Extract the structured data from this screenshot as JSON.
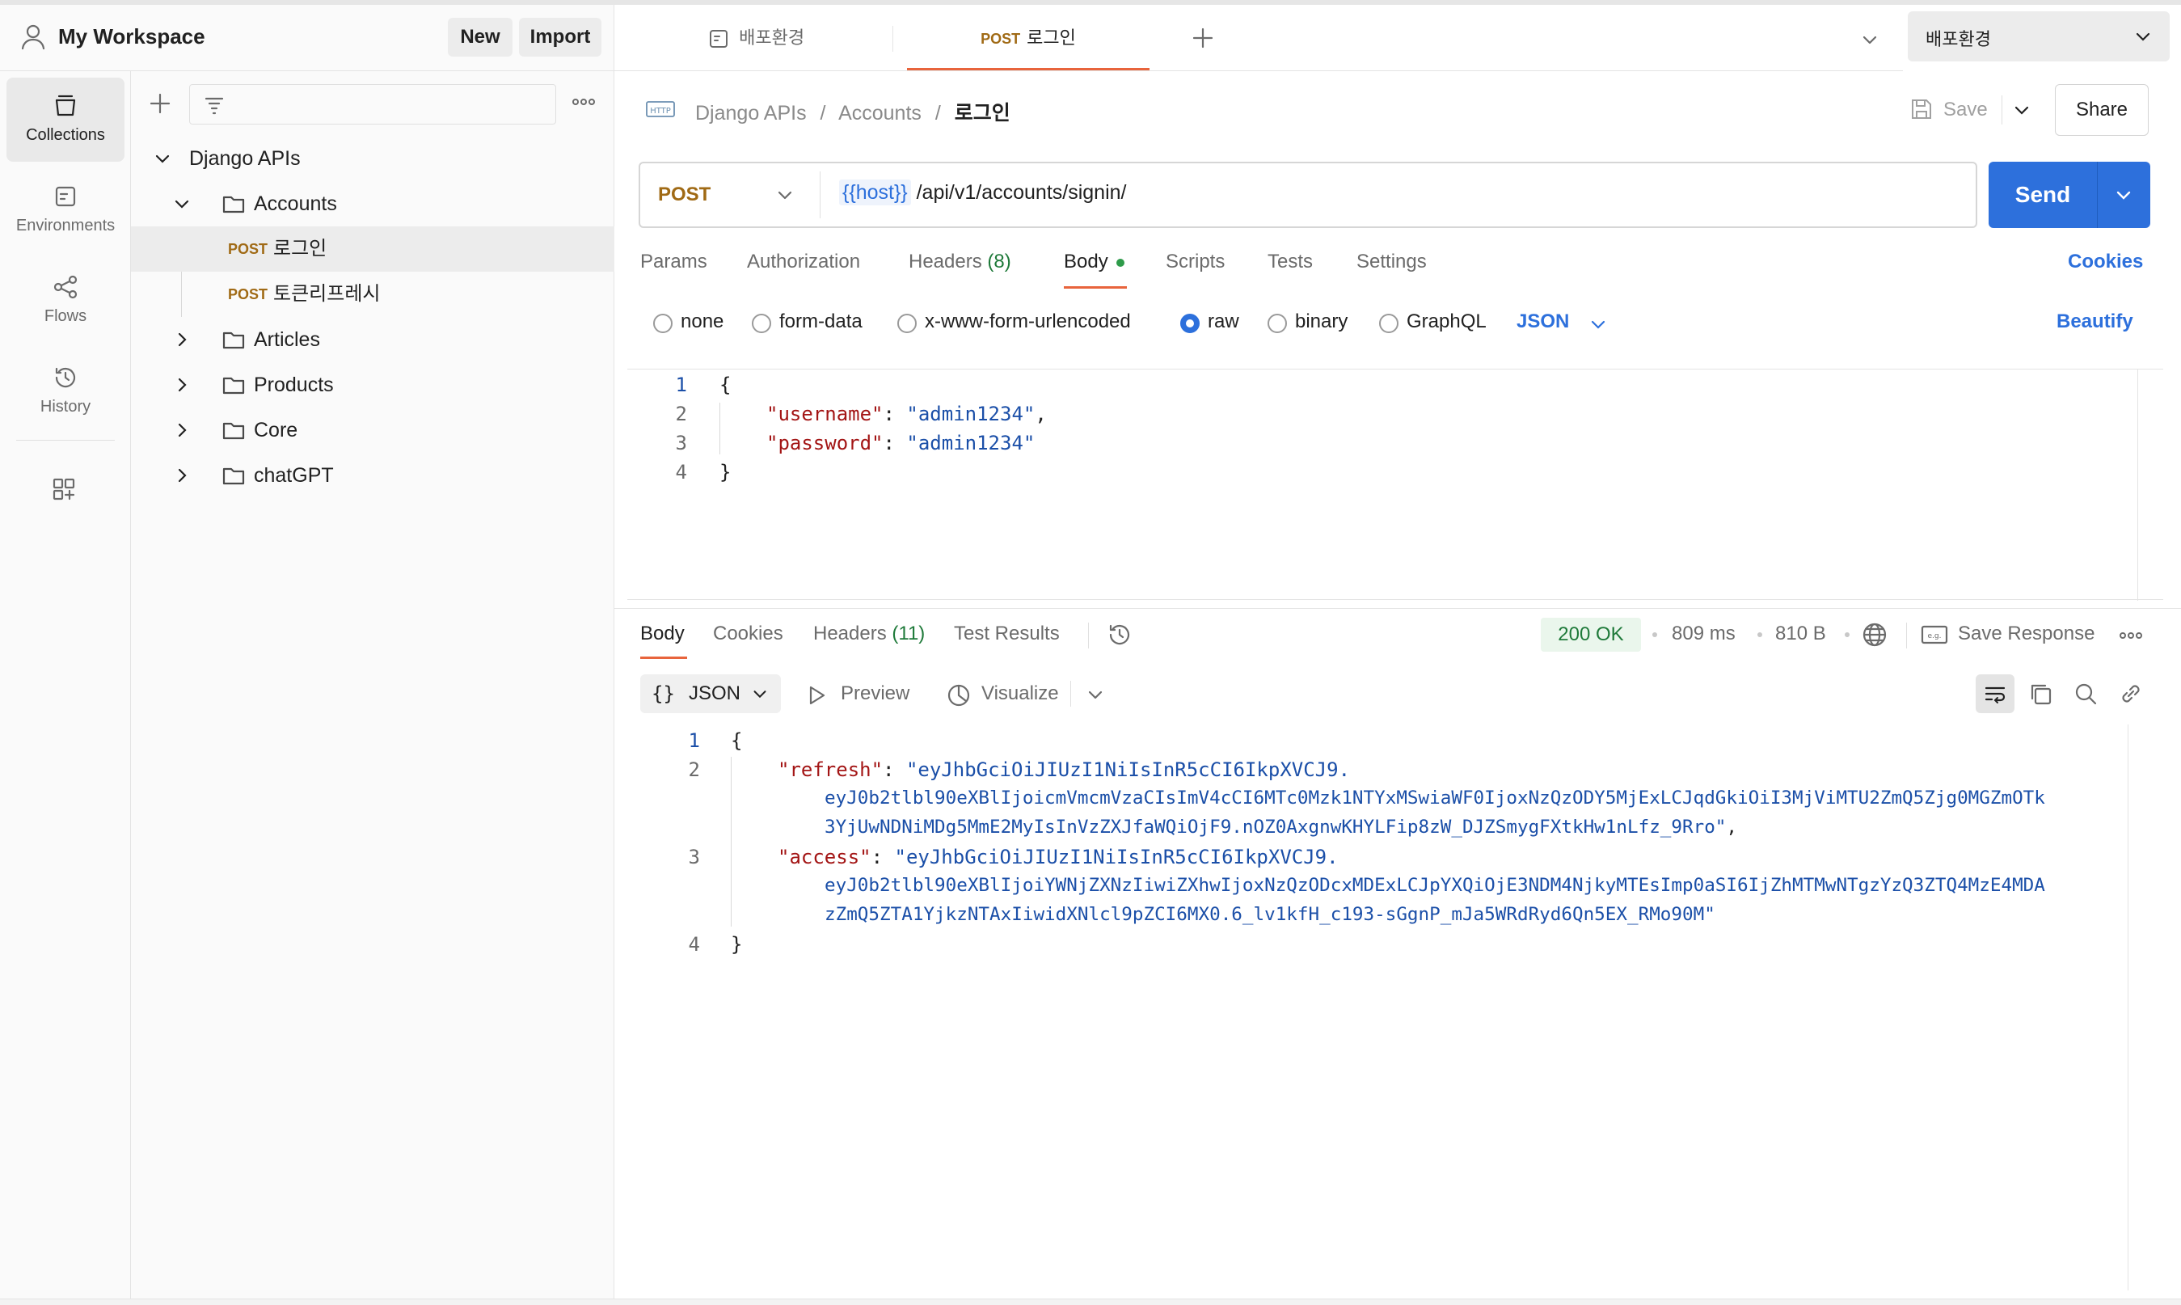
{
  "workspace": {
    "title": "My Workspace",
    "new_label": "New",
    "import_label": "Import"
  },
  "tabs": [
    {
      "label": "배포환경"
    },
    {
      "method": "POST",
      "label": "로그인"
    }
  ],
  "environment": {
    "selected": "배포환경"
  },
  "rail": [
    {
      "label": "Collections",
      "icon": "collections-icon"
    },
    {
      "label": "Environments",
      "icon": "environments-icon"
    },
    {
      "label": "Flows",
      "icon": "flows-icon"
    },
    {
      "label": "History",
      "icon": "history-icon"
    }
  ],
  "tree": {
    "root": "Django APIs",
    "accounts": "Accounts",
    "requests": [
      {
        "method": "POST",
        "label": "로그인"
      },
      {
        "method": "POST",
        "label": "토큰리프레시"
      }
    ],
    "folders": [
      "Articles",
      "Products",
      "Core",
      "chatGPT"
    ]
  },
  "breadcrumb": {
    "collection": "Django APIs",
    "folder": "Accounts",
    "request": "로그인",
    "sep": "/"
  },
  "toolbar": {
    "save_label": "Save",
    "share_label": "Share"
  },
  "request": {
    "method": "POST",
    "host_var": "{{host}}",
    "path": "/api/v1/accounts/signin/",
    "send_label": "Send"
  },
  "request_tabs": {
    "params": "Params",
    "authorization": "Authorization",
    "headers": "Headers",
    "headers_count": "(8)",
    "body": "Body",
    "scripts": "Scripts",
    "tests": "Tests",
    "settings": "Settings",
    "cookies": "Cookies"
  },
  "body_types": {
    "none": "none",
    "form_data": "form-data",
    "urlencoded": "x-www-form-urlencoded",
    "raw": "raw",
    "binary": "binary",
    "graphql": "GraphQL",
    "format": "JSON",
    "beautify": "Beautify"
  },
  "request_body": {
    "lines": [
      "1",
      "2",
      "3",
      "4"
    ],
    "open": "{",
    "close": "}",
    "username_key": "\"username\"",
    "username_val": "\"admin1234\"",
    "password_key": "\"password\"",
    "password_val": "\"admin1234\""
  },
  "response_tabs": {
    "body": "Body",
    "cookies": "Cookies",
    "headers": "Headers",
    "headers_count": "(11)",
    "test_results": "Test Results"
  },
  "response_meta": {
    "status": "200 OK",
    "time": "809 ms",
    "size": "810 B",
    "save_response": "Save Response",
    "status_color": "#1f7a3a"
  },
  "response_view": {
    "format": "JSON",
    "preview": "Preview",
    "visualize": "Visualize"
  },
  "response_body": {
    "lines": [
      "1",
      "2",
      "3",
      "4"
    ],
    "open": "{",
    "close": "}",
    "refresh_key": "\"refresh\"",
    "refresh_l1": "\"eyJhbGciOiJIUzI1NiIsInR5cCI6IkpXVCJ9.",
    "refresh_l2": "eyJ0b2tlbl90eXBlIjoicmVmcmVzaCIsImV4cCI6MTc0Mzk1NTYxMSwiaWF0IjoxNzQzODY5MjExLCJqdGkiOiI3MjViMTU2ZmQ5Zjg0MGZmOTk",
    "refresh_l3": "3YjUwNDNiMDg5MmE2MyIsInVzZXJfaWQiOjF9.nOZ0AxgnwKHYLFip8zW_DJZSmygFXtkHw1nLfz_9Rro\"",
    "access_key": "\"access\"",
    "access_l1": "\"eyJhbGciOiJIUzI1NiIsInR5cCI6IkpXVCJ9.",
    "access_l2": "eyJ0b2tlbl90eXBlIjoiYWNjZXNzIiwiZXhwIjoxNzQzODcxMDExLCJpYXQiOjE3NDM4NjkyMTEsImp0aSI6IjZhMTMwNTgzYzQ3ZTQ4MzE4MDA",
    "access_l3": "zZmQ5ZTA1YjkzNTAxIiwidXNlcl9pZCI6MX0.6_lv1kfH_c193-sGgnP_mJa5WRdRyd6Qn5EX_RMo90M\""
  },
  "colors": {
    "accent": "#2d70dc",
    "post": "#a06a15",
    "tab_underline": "#e8643c"
  }
}
